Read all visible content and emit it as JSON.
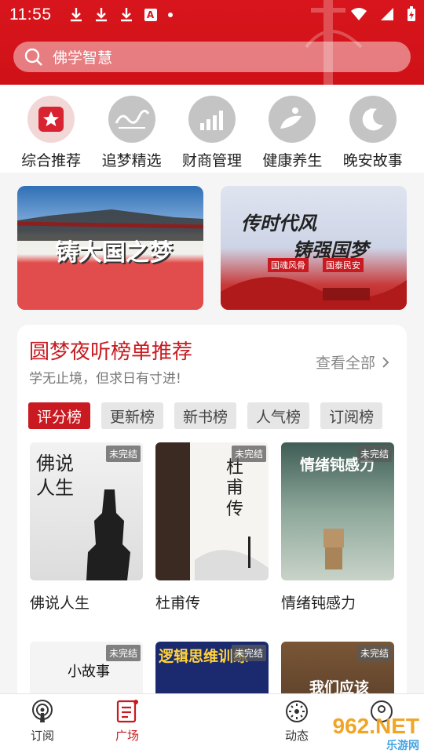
{
  "status": {
    "time": "11:55"
  },
  "search": {
    "placeholder": "佛学智慧"
  },
  "categories": [
    {
      "name": "综合推荐",
      "icon": "star-icon",
      "active": true
    },
    {
      "name": "追梦精选",
      "icon": "dream-logo-icon"
    },
    {
      "name": "财商管理",
      "icon": "bar-chart-icon"
    },
    {
      "name": "健康养生",
      "icon": "leaf-person-icon"
    },
    {
      "name": "晚安故事",
      "icon": "moon-icon"
    }
  ],
  "banners": [
    {
      "text": "铸大国之梦"
    },
    {
      "line1": "传时代风",
      "line2": "铸强国梦",
      "tag1": "国魂风骨",
      "tag2": "国泰民安"
    }
  ],
  "rank": {
    "title": "圆梦夜听榜单推荐",
    "subtitle": "学无止境，但求日有寸进!",
    "view_all": "查看全部",
    "tabs": [
      "评分榜",
      "更新榜",
      "新书榜",
      "人气榜",
      "订阅榜"
    ],
    "books": [
      {
        "name": "佛说人生",
        "status": "未完结",
        "cover_text": "佛说人生"
      },
      {
        "name": "杜甫传",
        "status": "未完结",
        "cover_text": "杜甫传"
      },
      {
        "name": "情绪钝感力",
        "status": "未完结",
        "cover_text": "情绪钝感力"
      },
      {
        "name": "",
        "status": "未完结",
        "cover_text": "小故事"
      },
      {
        "name": "",
        "status": "未完结",
        "cover_text": "逻辑思维训练"
      },
      {
        "name": "",
        "status": "未完结",
        "cover_text": "我们应该"
      }
    ]
  },
  "nav": {
    "items": [
      {
        "label": "订阅",
        "icon": "podcast-icon"
      },
      {
        "label": "广场",
        "icon": "list-icon",
        "active": true
      },
      {
        "label": "",
        "icon": "disc-icon"
      },
      {
        "label": "动态",
        "icon": "dynamic-icon"
      },
      {
        "label": "",
        "icon": "profile-icon"
      }
    ]
  },
  "watermark": {
    "main": "962.NET",
    "sub": "乐游网"
  },
  "colors": {
    "brand_red": "#d8151c",
    "accent_red": "#c81a20"
  }
}
